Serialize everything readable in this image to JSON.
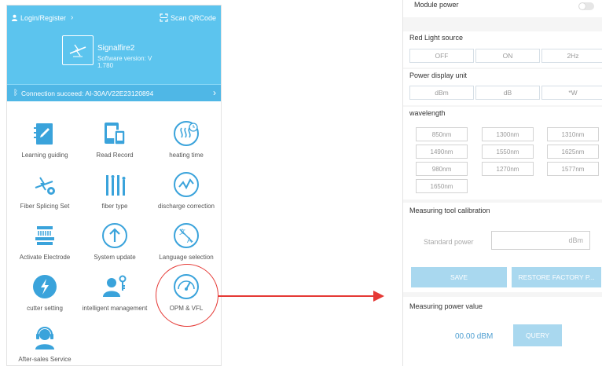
{
  "left_app": {
    "login_label": "Login/Register",
    "scan_label": "Scan QRCode",
    "device_name": "Signalfire2",
    "software_version": "Software version: V 1.780",
    "connection_status": "Connection succeed: AI-30A/V22E23120894",
    "menu_items": [
      {
        "label": "Learning guiding",
        "icon": "notebook-pen-icon"
      },
      {
        "label": "Read Record",
        "icon": "tablet-records-icon"
      },
      {
        "label": "heating time",
        "icon": "heating-clock-icon"
      },
      {
        "label": "Fiber Splicing Set",
        "icon": "splice-gear-icon"
      },
      {
        "label": "fiber type",
        "icon": "fiber-type-icon"
      },
      {
        "label": "discharge correction",
        "icon": "discharge-wave-icon"
      },
      {
        "label": "Activate Electrode",
        "icon": "electrode-icon"
      },
      {
        "label": "System update",
        "icon": "upload-arrow-icon"
      },
      {
        "label": "Language selection",
        "icon": "language-icon"
      },
      {
        "label": "cutter setting",
        "icon": "cutter-bolt-icon"
      },
      {
        "label": "intelligent management",
        "icon": "user-key-icon"
      },
      {
        "label": "OPM & VFL",
        "icon": "gauge-icon"
      },
      {
        "label": "After-sales Service",
        "icon": "headset-agent-icon"
      }
    ]
  },
  "right_app": {
    "module_power_label": "Module power",
    "module_power_on": false,
    "red_light_title": "Red Light source",
    "red_light_options": [
      "OFF",
      "ON",
      "2Hz"
    ],
    "power_unit_title": "Power display unit",
    "power_unit_options": [
      "dBm",
      "dB",
      "*W"
    ],
    "wavelength_title": "wavelength",
    "wavelengths": [
      "850nm",
      "1300nm",
      "1310nm",
      "1490nm",
      "1550nm",
      "1625nm",
      "980nm",
      "1270nm",
      "1577nm",
      "1650nm"
    ],
    "calibration_title": "Measuring tool calibration",
    "standard_power_label": "Standard power",
    "standard_power_unit": "dBm",
    "save_label": "SAVE",
    "restore_label": "RESTORE FACTORY P...",
    "measuring_title": "Measuring power value",
    "measured_value": "00.00  dBM",
    "query_label": "QUERY"
  },
  "colors": {
    "header_blue": "#5cc4ee",
    "icon_blue": "#3aa3db",
    "button_blue": "#a9d8ef",
    "highlight_red": "#e53935"
  }
}
